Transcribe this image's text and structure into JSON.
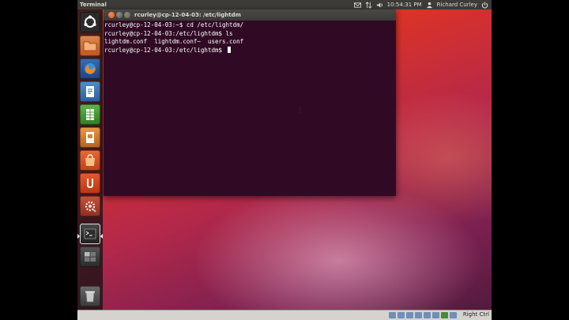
{
  "panel": {
    "app_title": "Terminal",
    "clock": "10:54:31 PM",
    "user_name": "Richard Curley"
  },
  "launcher": {
    "items": [
      {
        "name": "dash-home",
        "color": "#2b2b2b"
      },
      {
        "name": "files",
        "color": "#d26b28"
      },
      {
        "name": "firefox",
        "color": "#2a5b9a"
      },
      {
        "name": "writer",
        "color": "#2f6fb0"
      },
      {
        "name": "calc",
        "color": "#3c9a2e"
      },
      {
        "name": "impress",
        "color": "#c86a1e"
      },
      {
        "name": "software-center",
        "color": "#d9491a"
      },
      {
        "name": "ubuntu-one",
        "color": "#d0421e"
      },
      {
        "name": "system-settings",
        "color": "#b43c24"
      },
      {
        "name": "terminal",
        "color": "#2d2d2d"
      },
      {
        "name": "workspace-switcher",
        "color": "#3a3a3a"
      },
      {
        "name": "trash",
        "color": "#5a5a5a"
      }
    ]
  },
  "terminal": {
    "title": "rcurley@cp-12-04-03: /etc/lightdm",
    "lines": [
      "rcurley@cp-12-04-03:~$ cd /etc/lightdm/",
      "rcurley@cp-12-04-03:/etc/lightdm$ ls",
      "lightdm.conf  lightdm.conf~  users.conf",
      "rcurley@cp-12-04-03:/etc/lightdm$ "
    ]
  },
  "vm_bar": {
    "host_key": "Right Ctrl"
  }
}
